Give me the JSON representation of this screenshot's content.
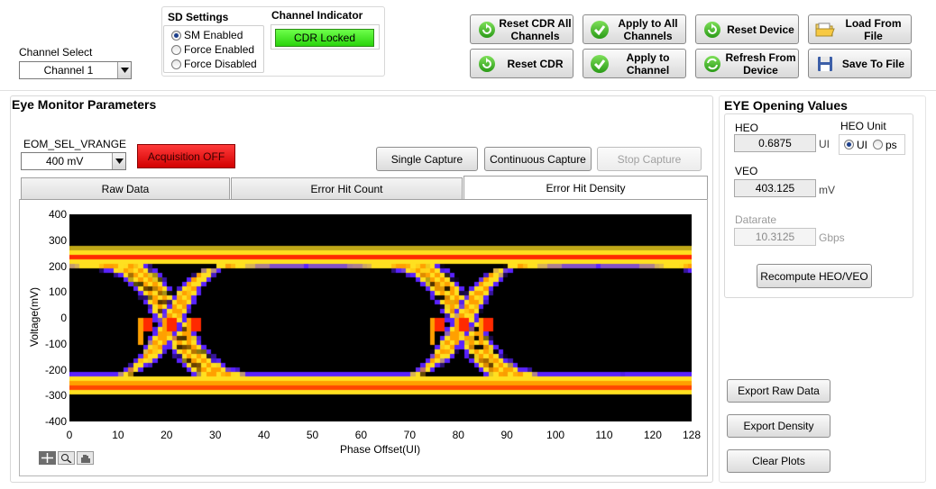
{
  "channel_select": {
    "label": "Channel Select",
    "value": "Channel 1"
  },
  "sd_settings": {
    "title": "SD Settings",
    "options": [
      {
        "label": "SM Enabled",
        "selected": true
      },
      {
        "label": "Force Enabled",
        "selected": false
      },
      {
        "label": "Force Disabled",
        "selected": false
      }
    ]
  },
  "channel_indicator": {
    "title": "Channel Indicator",
    "status": "CDR Locked",
    "color": "#33dd11"
  },
  "toolbar": {
    "reset_cdr_all": "Reset CDR All Channels",
    "reset_cdr": "Reset CDR",
    "apply_all": "Apply to All Channels",
    "apply_channel": "Apply to Channel",
    "reset_device": "Reset Device",
    "refresh_device": "Refresh From Device",
    "load_file": "Load From File",
    "save_file": "Save To File"
  },
  "eye_monitor": {
    "title": "Eye Monitor Parameters",
    "vrange_label": "EOM_SEL_VRANGE",
    "vrange_value": "400 mV",
    "acquisition": "Acquisition OFF",
    "acquisition_color": "#e81010",
    "single_capture": "Single Capture",
    "continuous_capture": "Continuous Capture",
    "stop_capture": "Stop Capture",
    "tabs": [
      "Raw Data",
      "Error Hit Count",
      "Error Hit Density"
    ],
    "active_tab": 2
  },
  "chart_data": {
    "type": "heatmap",
    "title": "",
    "xlabel": "Phase Offset(UI)",
    "ylabel": "Voltage(mV)",
    "xlim": [
      0,
      128
    ],
    "ylim": [
      -400,
      400
    ],
    "x_ticks": [
      "0",
      "10",
      "20",
      "30",
      "40",
      "50",
      "60",
      "70",
      "80",
      "90",
      "100",
      "110",
      "120",
      "128"
    ],
    "y_ticks": [
      "400",
      "300",
      "200",
      "100",
      "0",
      "-100",
      "-200",
      "-300",
      "-400"
    ],
    "x_tick_values": [
      0,
      10,
      20,
      30,
      40,
      50,
      60,
      70,
      80,
      90,
      100,
      110,
      120,
      128
    ],
    "y_tick_values": [
      400,
      300,
      200,
      100,
      0,
      -100,
      -200,
      -300,
      -400
    ],
    "eye_crossings_ui": [
      21,
      81
    ],
    "rail_levels_mv": [
      240,
      -260
    ],
    "colormap": [
      "#000000",
      "#5a22ff",
      "#ffe020",
      "#ffa000",
      "#ff2a00"
    ]
  },
  "eye_opening": {
    "title": "EYE Opening Values",
    "heo_label": "HEO",
    "heo_value": "0.6875",
    "heo_unit": "UI",
    "heo_unit_group": "HEO Unit",
    "heo_unit_options": [
      {
        "label": "UI",
        "selected": true
      },
      {
        "label": "ps",
        "selected": false
      }
    ],
    "veo_label": "VEO",
    "veo_value": "403.125",
    "veo_unit": "mV",
    "datarate_label": "Datarate",
    "datarate_value": "10.3125",
    "datarate_unit": "Gbps",
    "recompute": "Recompute HEO/VEO"
  },
  "export": {
    "raw": "Export Raw Data",
    "density": "Export Density",
    "clear": "Clear Plots"
  }
}
